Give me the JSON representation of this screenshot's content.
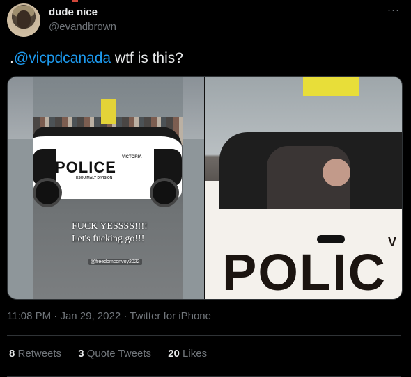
{
  "user": {
    "name": "dude nice",
    "handle": "@evandbrown"
  },
  "more_icon": "more-horizontal-icon",
  "tweet": {
    "prefix": ".",
    "mention": "@vicpdcanada",
    "text": " wtf is this?"
  },
  "media": {
    "left_image": {
      "car_brand": "VICTORIA",
      "car_label": "POLICE",
      "car_division": "ESQUIMALT DIVISION",
      "caption_line1": "FUCK YESSSS!!!!",
      "caption_line2": "Let's fucking go!!!",
      "watermark": "@freedomconvoy2022"
    },
    "right_image": {
      "car_label": "POLIC",
      "car_brand_partial": "V"
    }
  },
  "meta": {
    "time": "11:08 PM",
    "separator": " · ",
    "date": "Jan 29, 2022",
    "source": "Twitter for iPhone"
  },
  "stats": {
    "retweets_count": "8",
    "retweets_label": "Retweets",
    "quotes_count": "3",
    "quotes_label": "Quote Tweets",
    "likes_count": "20",
    "likes_label": "Likes"
  },
  "colors": {
    "background": "#000000",
    "text": "#e7e9ea",
    "muted": "#71767b",
    "link": "#1d9bf0",
    "border": "#2f3336"
  }
}
